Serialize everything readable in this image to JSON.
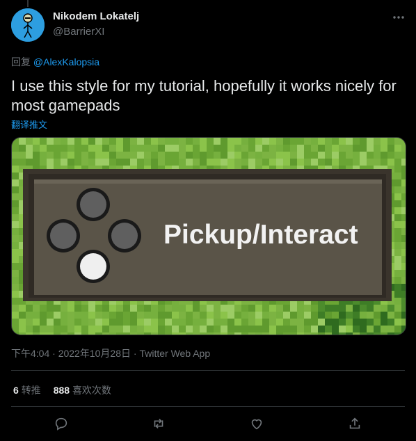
{
  "author": {
    "name": "Nikodem Lokatelj",
    "handle": "@BarrierXI"
  },
  "reply": {
    "prefix": "回复",
    "mention": "@AlexKalopsia"
  },
  "tweet": {
    "text": "I use this style for my tutorial, hopefully it works nicely for most gamepads",
    "translate_label": "翻译推文"
  },
  "media": {
    "prompt_label": "Pickup/Interact",
    "colors": {
      "grass": "#7cb342",
      "panel": "#5a5448",
      "button_dim": "#5f5f5f",
      "button_active": "#f0f0f0"
    }
  },
  "meta": {
    "time": "下午4:04",
    "date": "2022年10月28日",
    "source": "Twitter Web App"
  },
  "stats": {
    "retweets_count": "6",
    "retweets_label": "转推",
    "likes_count": "888",
    "likes_label": "喜欢次数"
  },
  "actions": [
    {
      "icon": "reply-icon"
    },
    {
      "icon": "retweet-icon"
    },
    {
      "icon": "like-icon"
    },
    {
      "icon": "share-icon"
    }
  ]
}
